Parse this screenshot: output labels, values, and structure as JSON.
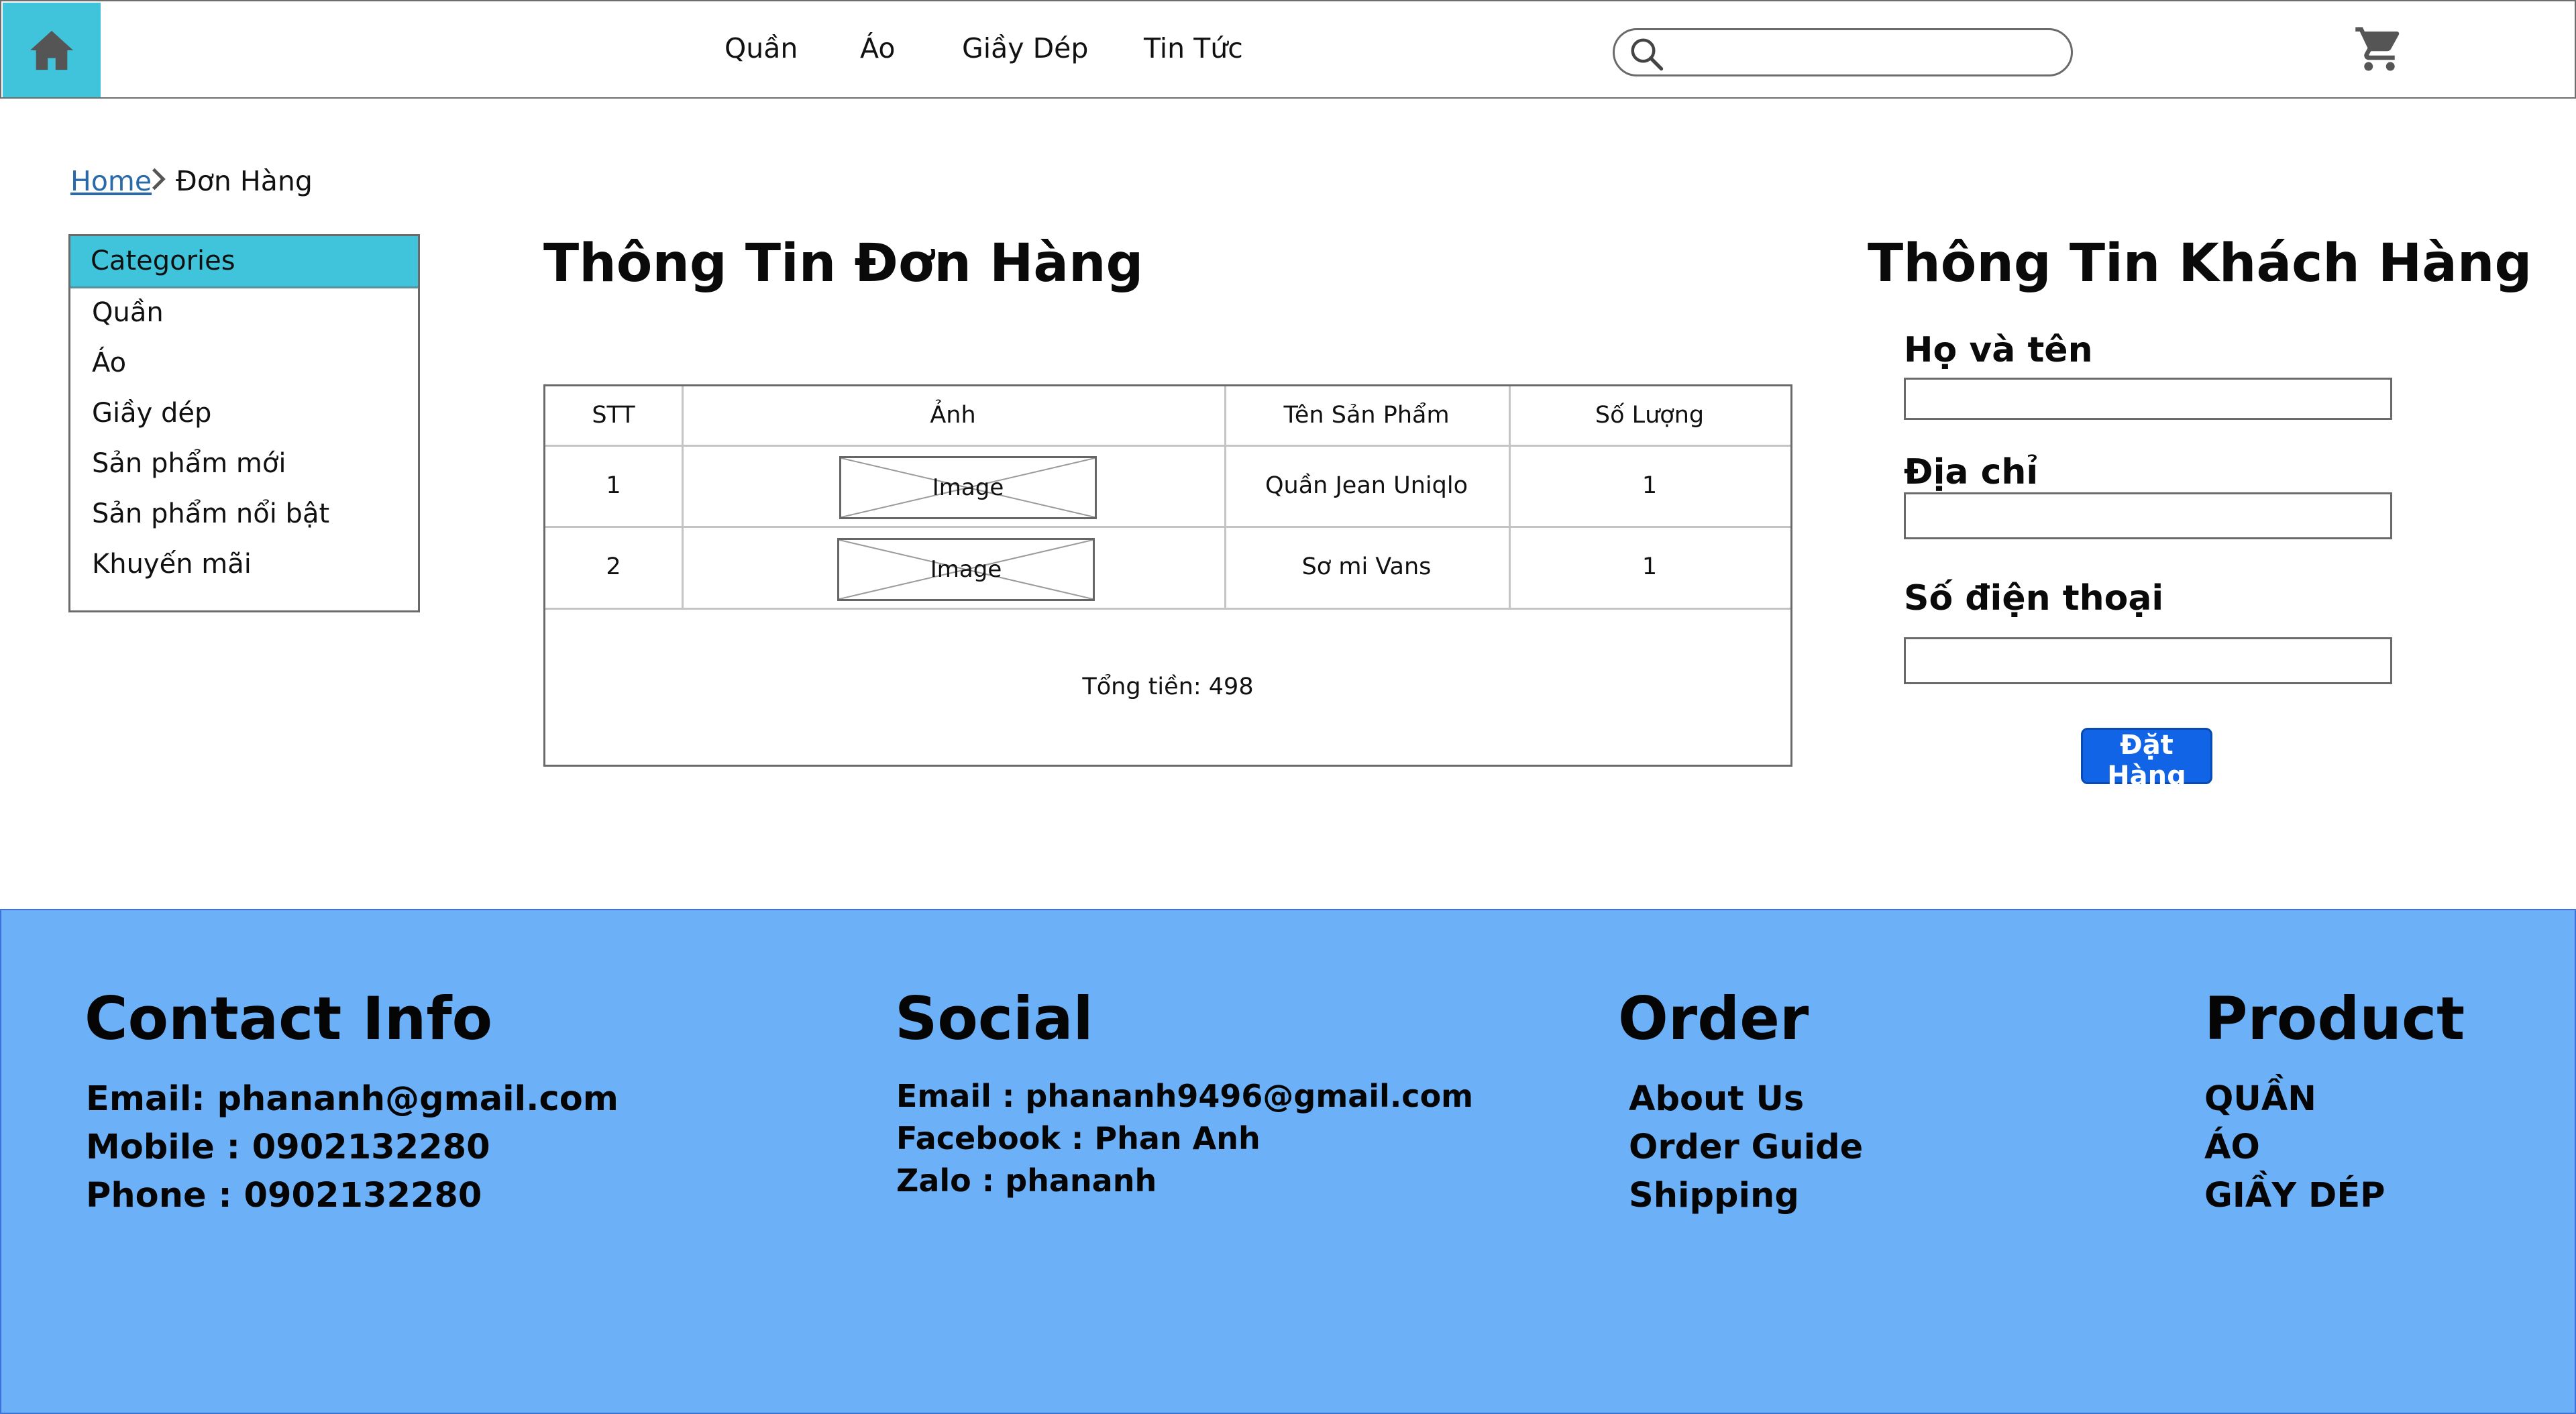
{
  "header": {
    "nav": [
      "Quần",
      "Áo",
      "Giầy Dép",
      "Tin Tức"
    ],
    "search": {
      "value": "",
      "placeholder": ""
    },
    "icons": {
      "home": "home-icon",
      "search": "search-icon",
      "cart": "cart-icon"
    },
    "colors": {
      "home_bg": "#40c4dc"
    }
  },
  "breadcrumb": {
    "home": "Home",
    "current": "Đơn Hàng"
  },
  "categories": {
    "title": "Categories",
    "items": [
      "Quần",
      "Áo",
      "Giầy dép",
      "Sản phẩm mới",
      "Sản phẩm nổi bật",
      "Khuyến mãi"
    ]
  },
  "order": {
    "title": "Thông Tin Đơn Hàng",
    "columns": [
      "STT",
      "Ảnh",
      "Tên Sản Phẩm",
      "Số Lượng"
    ],
    "rows": [
      {
        "stt": "1",
        "image": "Image",
        "name": "Quần Jean Uniqlo",
        "qty": "1"
      },
      {
        "stt": "2",
        "image": "Image",
        "name": "Sơ mi Vans",
        "qty": "1"
      }
    ],
    "total": "Tổng tiền: 498"
  },
  "customer": {
    "title": "Thông Tin Khách Hàng",
    "fields": [
      {
        "label": "Họ và tên",
        "value": ""
      },
      {
        "label": "Địa chỉ",
        "value": ""
      },
      {
        "label": "Số điện thoại",
        "value": ""
      }
    ],
    "submit": "Đặt Hàng",
    "colors": {
      "submit_bg": "#1264e6"
    }
  },
  "footer": {
    "bg_color": "#6cb0f8",
    "contact": {
      "title": "Contact Info",
      "lines": [
        "Email: phananh@gmail.com",
        "Mobile : 0902132280",
        "Phone : 0902132280"
      ]
    },
    "social": {
      "title": "Social",
      "lines": [
        "Email : phananh9496@gmail.com",
        "Facebook : Phan Anh",
        "Zalo : phananh"
      ]
    },
    "order": {
      "title": "Order",
      "links": [
        "About Us",
        "Order Guide",
        "Shipping"
      ]
    },
    "product": {
      "title": "Product",
      "links": [
        "QUẦN",
        "ÁO",
        "GIẦY DÉP"
      ]
    }
  }
}
